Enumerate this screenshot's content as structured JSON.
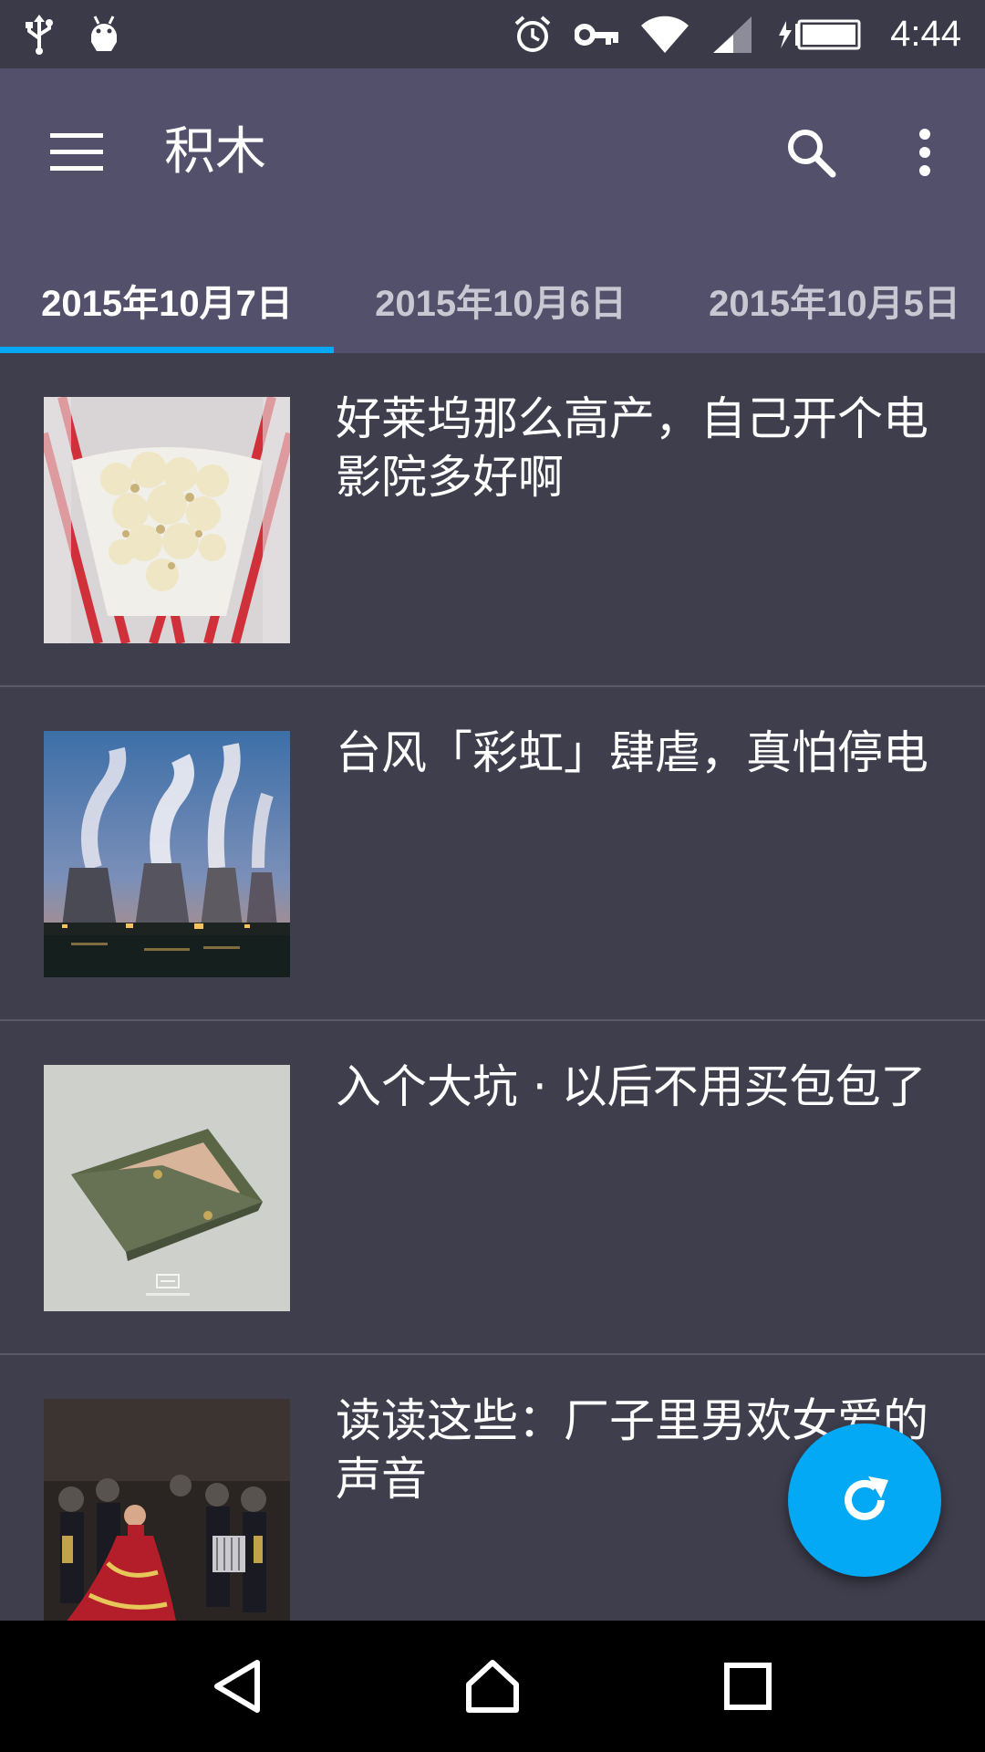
{
  "status_bar": {
    "time": "4:44",
    "icons": [
      "usb-icon",
      "android-debug-icon",
      "alarm-icon",
      "vpn-key-icon",
      "wifi-icon",
      "cell-signal-icon",
      "battery-charging-icon"
    ]
  },
  "toolbar": {
    "title": "积木",
    "menu_icon": "hamburger-menu-icon",
    "search_icon": "search-icon",
    "more_icon": "more-vert-icon"
  },
  "tabs": [
    {
      "label": "2015年10月7日",
      "active": true
    },
    {
      "label": "2015年10月6日",
      "active": false
    },
    {
      "label": "2015年10月5日",
      "active": false
    }
  ],
  "articles": [
    {
      "title": "好莱坞那么高产，自己开个电影院多好啊",
      "thumb": "popcorn"
    },
    {
      "title": "台风「彩虹」肆虐，真怕停电",
      "thumb": "power-plant"
    },
    {
      "title": "入个大坑 · 以后不用买包包了",
      "thumb": "wallet"
    },
    {
      "title": "读读这些：厂子里男欢女爱的声音",
      "thumb": "dancers"
    }
  ],
  "fab": {
    "icon": "refresh-icon"
  },
  "nav_bar": {
    "icons": [
      "back-icon",
      "home-icon",
      "recents-icon"
    ]
  },
  "colors": {
    "app_bar": "#52506a",
    "background": "#3f3e4d",
    "accent": "#03a9f4",
    "status_bar": "#3b3a48"
  }
}
